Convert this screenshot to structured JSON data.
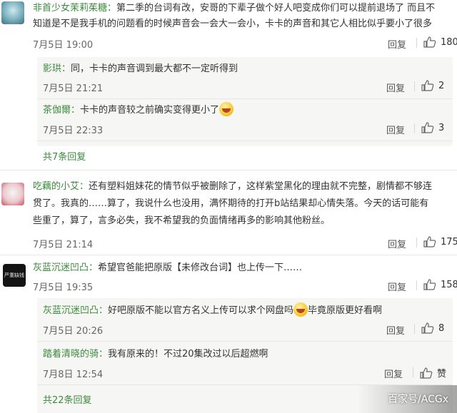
{
  "comments": [
    {
      "username": "非首少女茉莉茱糖：",
      "lines": [
        "第二季的台词有改，安哥的下辈子做个好人吧变成你们可以提前退场了 而且不",
        "知道是不是我手机的问题看的时候声音会一会大一会小，卡卡的声音和其它人相比似乎要小了很多"
      ],
      "time": "7月5日 19:00",
      "reply_label": "回复",
      "likes": "180",
      "replies": [
        {
          "username": "影珙：",
          "text": "同，卡卡的声音调到最大都不一定听得到",
          "time": "7月5日 21:21",
          "reply_label": "回复",
          "likes": "2"
        },
        {
          "username": "茶伽爾：",
          "text": "卡卡的声音较之前确实变得更小了",
          "time": "7月5日 22:33",
          "reply_label": "回复",
          "likes": "3"
        }
      ],
      "more_label": "共7条回复"
    },
    {
      "username": "吃藕的小艾：",
      "lines": [
        "还有塑料姐妹花的情节似乎被删除了，这样紫堂黑化的理由就不完整，剧情都不够连",
        "贯了。我真的……算了，我说什么也没用，满怀期待的打开b站结果却心情失落。今天的话可能有",
        "些重了，算了，言多必失，我不希望我的负面情绪再多的影响其他粉丝。"
      ],
      "time": "7月5日 21:14",
      "reply_label": "回复",
      "likes": "175"
    },
    {
      "avatar_text": "严重缺钱",
      "username": "灰蓝沉迷凹凸：",
      "lines": [
        "希望官爸能把原版【未修改台词】也上传一下……"
      ],
      "time": "7月5日 19:35",
      "reply_label": "回复",
      "likes": "158",
      "replies": [
        {
          "username": "灰蓝沉迷凹凸：",
          "text": "好吧原版不能以官方名义上传可以求个网盘吗",
          "text_after": "毕竟原版更好看啊",
          "time": "7月5日 20:26",
          "reply_label": "回复",
          "likes": "8"
        },
        {
          "username": "踏着清晓的骑：",
          "text": "我有原来的！不过20集改过以后超燃啊",
          "time": "7月8日 12:54",
          "reply_label": "回复",
          "likes": "赞"
        }
      ],
      "more_label": "共22条回复"
    }
  ],
  "watermark": "百家号/ACGx",
  "colors": {
    "username": "#3c8a3c",
    "subreply_bg": "#f6f7f5",
    "text": "#333333"
  },
  "icons": {
    "like": "thumbs-up-icon",
    "emoji": "laughing-face-emoji"
  }
}
